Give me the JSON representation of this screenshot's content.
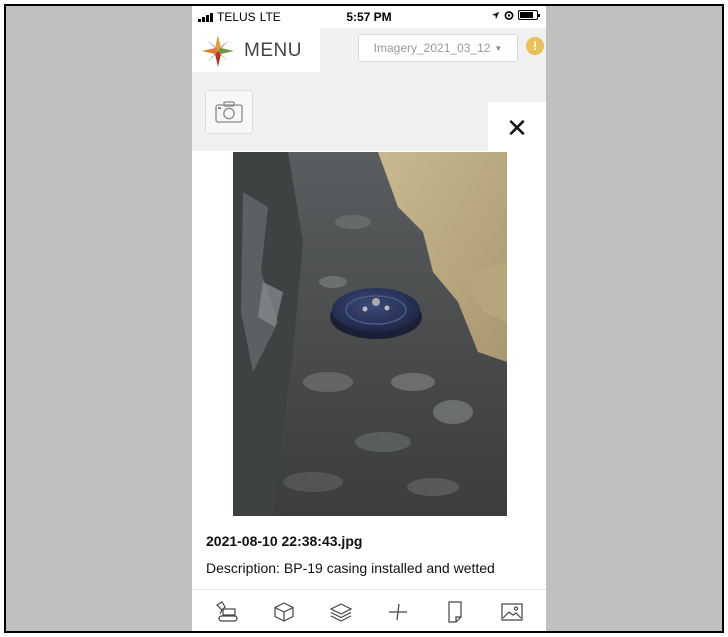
{
  "status_bar": {
    "carrier": "TELUS",
    "network": "LTE",
    "time": "5:57 PM"
  },
  "header": {
    "menu_label": "MENU",
    "imagery_selected": "Imagery_2021_03_12",
    "warning_symbol": "!"
  },
  "viewer": {
    "close_symbol": "✕",
    "photo_subject": "BP-19 casing in trench",
    "filename": "2021-08-10 22:38:43.jpg",
    "description_label": "Description:",
    "description_text": "BP-19 casing installed and wetted"
  },
  "toolbar": {
    "tools": [
      {
        "icon": "excavator-icon"
      },
      {
        "icon": "cube-icon"
      },
      {
        "icon": "layers-icon"
      },
      {
        "icon": "measure-icon"
      },
      {
        "icon": "document-icon"
      },
      {
        "icon": "image-icon"
      }
    ]
  },
  "colors": {
    "background": "#c0c0c0",
    "phone_background": "#eef0f2",
    "warning": "#e8c15a",
    "text": "#111111"
  }
}
